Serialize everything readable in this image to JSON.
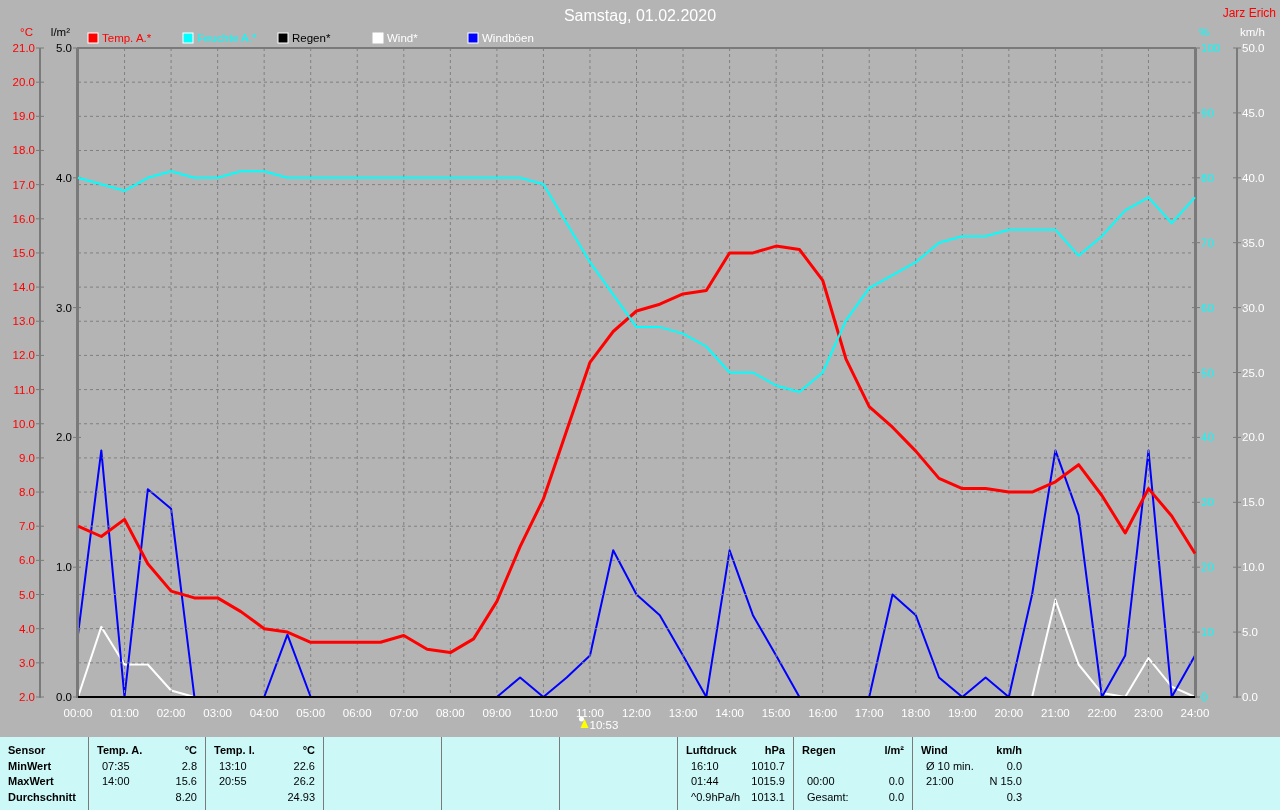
{
  "header": {
    "title": "Samstag, 01.02.2020",
    "author": "Jarz Erich"
  },
  "chart": {
    "chart_data": {
      "type": "line",
      "xlim": [
        0,
        24
      ],
      "grid": true,
      "legend": "top",
      "xticks": [
        {
          "value": 0,
          "label": "00:00"
        },
        {
          "value": 1,
          "label": "01:00"
        },
        {
          "value": 2,
          "label": "02:00"
        },
        {
          "value": 3,
          "label": "03:00"
        },
        {
          "value": 4,
          "label": "04:00"
        },
        {
          "value": 5,
          "label": "05:00"
        },
        {
          "value": 6,
          "label": "06:00"
        },
        {
          "value": 7,
          "label": "07:00"
        },
        {
          "value": 8,
          "label": "08:00"
        },
        {
          "value": 9,
          "label": "09:00"
        },
        {
          "value": 10,
          "label": "10:00"
        },
        {
          "value": 11,
          "label": "11:00"
        },
        {
          "value": 12,
          "label": "12:00"
        },
        {
          "value": 13,
          "label": "13:00"
        },
        {
          "value": 14,
          "label": "14:00"
        },
        {
          "value": 15,
          "label": "15:00"
        },
        {
          "value": 16,
          "label": "16:00"
        },
        {
          "value": 17,
          "label": "17:00"
        },
        {
          "value": 18,
          "label": "18:00"
        },
        {
          "value": 19,
          "label": "19:00"
        },
        {
          "value": 20,
          "label": "20:00"
        },
        {
          "value": 21,
          "label": "21:00"
        },
        {
          "value": 22,
          "label": "22:00"
        },
        {
          "value": 23,
          "label": "23:00"
        },
        {
          "value": 24,
          "label": "24:00"
        }
      ],
      "ylabel": "°C",
      "ylim": [
        2,
        21
      ],
      "yticks": [
        {
          "value": 2,
          "label": "2.0"
        },
        {
          "value": 3,
          "label": "3.0"
        },
        {
          "value": 4,
          "label": "4.0"
        },
        {
          "value": 5,
          "label": "5.0"
        },
        {
          "value": 6,
          "label": "6.0"
        },
        {
          "value": 7,
          "label": "7.0"
        },
        {
          "value": 8,
          "label": "8.0"
        },
        {
          "value": 9,
          "label": "9.0"
        },
        {
          "value": 10,
          "label": "10.0"
        },
        {
          "value": 11,
          "label": "11.0"
        },
        {
          "value": 12,
          "label": "12.0"
        },
        {
          "value": 13,
          "label": "13.0"
        },
        {
          "value": 14,
          "label": "14.0"
        },
        {
          "value": 15,
          "label": "15.0"
        },
        {
          "value": 16,
          "label": "16.0"
        },
        {
          "value": 17,
          "label": "17.0"
        },
        {
          "value": 18,
          "label": "18.0"
        },
        {
          "value": 19,
          "label": "19.0"
        },
        {
          "value": 20,
          "label": "20.0"
        },
        {
          "value": 21,
          "label": "21.0"
        }
      ],
      "y2label": "l/m²",
      "y2lim": [
        0,
        5
      ],
      "y2ticks": [
        {
          "value": 0,
          "label": "0.0"
        },
        {
          "value": 1,
          "label": "1.0"
        },
        {
          "value": 2,
          "label": "2.0"
        },
        {
          "value": 3,
          "label": "3.0"
        },
        {
          "value": 4,
          "label": "4.0"
        },
        {
          "value": 5,
          "label": "5.0"
        }
      ],
      "y3label": "%",
      "y3lim": [
        0,
        100
      ],
      "y3ticks": [
        {
          "value": 0,
          "label": "0"
        },
        {
          "value": 10,
          "label": "10"
        },
        {
          "value": 20,
          "label": "20"
        },
        {
          "value": 30,
          "label": "30"
        },
        {
          "value": 40,
          "label": "40"
        },
        {
          "value": 50,
          "label": "50"
        },
        {
          "value": 60,
          "label": "60"
        },
        {
          "value": 70,
          "label": "70"
        },
        {
          "value": 80,
          "label": "80"
        },
        {
          "value": 90,
          "label": "90"
        },
        {
          "value": 100,
          "label": "100"
        }
      ],
      "x": [
        0,
        0.5,
        1,
        1.5,
        2,
        2.5,
        3,
        3.5,
        4,
        4.5,
        5,
        5.5,
        6,
        6.5,
        7,
        7.5,
        8,
        8.5,
        9,
        9.5,
        10,
        10.5,
        11,
        11.5,
        12,
        12.5,
        13,
        13.5,
        14,
        14.5,
        15,
        15.5,
        16,
        16.5,
        17,
        17.5,
        18,
        18.5,
        19,
        19.5,
        20,
        20.5,
        21,
        21.5,
        22,
        22.5,
        23,
        23.5,
        24
      ],
      "series": [
        {
          "name": "Temp. A.*",
          "color": "#ff0000",
          "values": [
            7.0,
            6.7,
            7.2,
            5.9,
            5.1,
            4.9,
            4.9,
            4.5,
            4.0,
            3.9,
            3.6,
            3.6,
            3.6,
            3.6,
            3.8,
            3.4,
            3.3,
            3.7,
            4.8,
            6.4,
            7.8,
            9.8,
            11.8,
            12.7,
            13.3,
            13.5,
            13.8,
            13.9,
            15.0,
            15.0,
            15.2,
            15.1,
            14.2,
            11.9,
            10.5,
            9.9,
            9.2,
            8.4,
            8.1,
            8.1,
            8.0,
            8.0,
            8.3,
            8.8,
            7.9,
            6.8,
            8.1,
            7.3,
            6.2
          ]
        },
        {
          "name": "Feuchte A.*",
          "color": "#00ffff",
          "axis": "y3",
          "values": [
            80,
            79,
            78,
            80,
            81,
            80,
            80,
            81,
            81,
            80,
            80,
            80,
            80,
            80,
            80,
            80,
            80,
            80,
            80,
            80,
            79,
            73,
            67,
            62,
            57,
            57,
            56,
            54,
            50,
            50,
            48,
            47,
            50,
            58,
            63,
            65,
            67,
            70,
            71,
            71,
            72,
            72,
            72,
            68,
            71,
            75,
            77,
            73,
            77
          ]
        },
        {
          "name": "Regen*",
          "color": "#000000",
          "axis": "y2",
          "values": [
            0,
            0,
            0,
            0,
            0,
            0,
            0,
            0,
            0,
            0,
            0,
            0,
            0,
            0,
            0,
            0,
            0,
            0,
            0,
            0,
            0,
            0,
            0,
            0,
            0,
            0,
            0,
            0,
            0,
            0,
            0,
            0,
            0,
            0,
            0,
            0,
            0,
            0,
            0,
            0,
            0,
            0,
            0,
            0,
            0,
            0,
            0,
            0,
            0
          ]
        }
      ],
      "annotations": [
        "10:53"
      ]
    }
  },
  "wind_chart": {
    "chart_data": {
      "type": "line",
      "xlim": [
        0,
        24
      ],
      "legend": "top",
      "ylabel": "km/h",
      "ylim": [
        0,
        50
      ],
      "yticks": [
        {
          "value": 0,
          "label": "0.0"
        },
        {
          "value": 5,
          "label": "5.0"
        },
        {
          "value": 10,
          "label": "10.0"
        },
        {
          "value": 15,
          "label": "15.0"
        },
        {
          "value": 20,
          "label": "20.0"
        },
        {
          "value": 25,
          "label": "25.0"
        },
        {
          "value": 30,
          "label": "30.0"
        },
        {
          "value": 35,
          "label": "35.0"
        },
        {
          "value": 40,
          "label": "40.0"
        },
        {
          "value": 45,
          "label": "45.0"
        },
        {
          "value": 50,
          "label": "50.0"
        }
      ],
      "x": [
        0,
        0.5,
        1,
        1.5,
        2,
        2.5,
        4,
        4.5,
        5,
        9,
        9.5,
        10,
        10.5,
        11,
        11.5,
        12,
        12.5,
        13,
        13.5,
        14,
        14.5,
        15,
        15.5,
        17,
        17.5,
        18,
        18.5,
        19,
        19.5,
        20,
        20.5,
        21,
        21.5,
        22,
        22.5,
        23,
        23.5,
        24
      ],
      "series": [
        {
          "name": "Wind*",
          "color": "#ffffff",
          "values": [
            0,
            5.4,
            2.5,
            2.5,
            0.5,
            0,
            null,
            null,
            null,
            null,
            null,
            null,
            null,
            null,
            null,
            null,
            null,
            null,
            null,
            null,
            null,
            null,
            null,
            null,
            null,
            null,
            null,
            null,
            null,
            null,
            0,
            7.5,
            2.5,
            0.3,
            0,
            3,
            0.8,
            0
          ]
        },
        {
          "name": "Windböen",
          "color": "#0000ff",
          "values": [
            4.8,
            19,
            0,
            16,
            14.5,
            0,
            0,
            4.8,
            0,
            0,
            1.5,
            0,
            1.5,
            3.2,
            11.3,
            7.9,
            6.3,
            3.2,
            0,
            11.3,
            6.3,
            3.2,
            0,
            0,
            7.9,
            6.3,
            1.5,
            0,
            1.5,
            0,
            7.9,
            19,
            14,
            0,
            3.2,
            19,
            0,
            3.2
          ]
        }
      ]
    }
  },
  "summary": {
    "row_labels": [
      "Sensor",
      "MinWert",
      "MaxWert",
      "Durchschnitt"
    ],
    "panels": [
      {
        "kind": "stats",
        "title": "Temp. A.",
        "unit": "°C",
        "rows": [
          {
            "time": "07:35",
            "value": "2.8"
          },
          {
            "time": "14:00",
            "value": "15.6"
          },
          {
            "value": "8.20"
          }
        ]
      },
      {
        "kind": "stats",
        "title": "Temp. I.",
        "unit": "°C",
        "rows": [
          {
            "time": "13:10",
            "value": "22.6"
          },
          {
            "time": "20:55",
            "value": "26.2"
          },
          {
            "value": "24.93"
          }
        ]
      },
      {
        "kind": "blank"
      },
      {
        "kind": "blank"
      },
      {
        "kind": "blank"
      },
      {
        "kind": "stats",
        "title": "Luftdruck",
        "unit": "hPa",
        "rows": [
          {
            "time": "16:10",
            "value": "1010.7"
          },
          {
            "time": "01:44",
            "value": "1015.9"
          },
          {
            "time": "^0.9hPa/h",
            "value": "1013.1"
          }
        ]
      },
      {
        "kind": "stats",
        "title": "Regen",
        "unit": "l/m²",
        "rows": [
          {},
          {
            "time": "00:00",
            "value": "0.0"
          },
          {
            "time": "Gesamt:",
            "value": "0.0"
          }
        ]
      },
      {
        "kind": "stats",
        "title": "Wind",
        "unit": "km/h",
        "rows": [
          {
            "time": "Ø 10 min.",
            "value": "0.0"
          },
          {
            "time": "21:00",
            "value": "N 15.0"
          },
          {
            "value": "0.3"
          }
        ]
      }
    ]
  }
}
